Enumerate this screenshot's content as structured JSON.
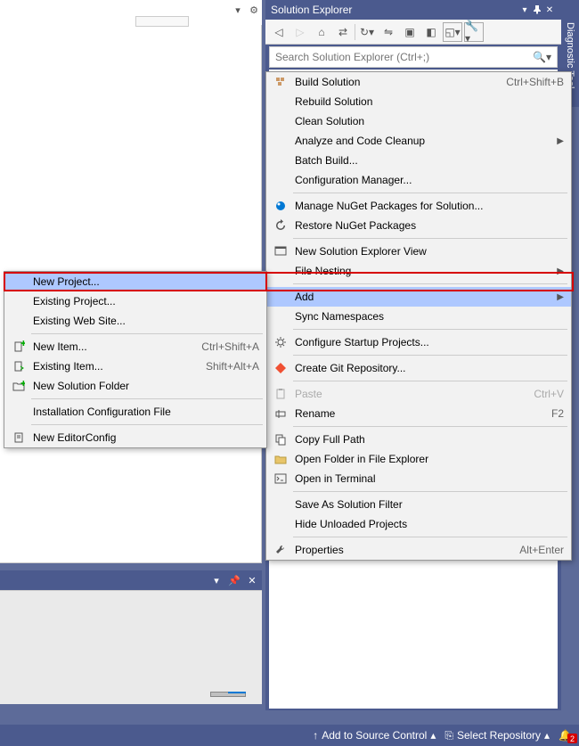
{
  "solution_explorer": {
    "title": "Solution Explorer",
    "search_placeholder": "Search Solution Explorer (Ctrl+;)"
  },
  "side_tab": "Diagnostic Tool",
  "main_menu": [
    {
      "icon": "build",
      "label": "Build Solution",
      "shortcut": "Ctrl+Shift+B"
    },
    {
      "icon": "",
      "label": "Rebuild Solution",
      "shortcut": ""
    },
    {
      "icon": "",
      "label": "Clean Solution",
      "shortcut": ""
    },
    {
      "icon": "",
      "label": "Analyze and Code Cleanup",
      "shortcut": "",
      "submenu": true
    },
    {
      "icon": "",
      "label": "Batch Build...",
      "shortcut": ""
    },
    {
      "icon": "",
      "label": "Configuration Manager...",
      "shortcut": ""
    },
    {
      "sep": true
    },
    {
      "icon": "nuget",
      "label": "Manage NuGet Packages for Solution...",
      "shortcut": ""
    },
    {
      "icon": "restore",
      "label": "Restore NuGet Packages",
      "shortcut": ""
    },
    {
      "sep": true
    },
    {
      "icon": "view",
      "label": "New Solution Explorer View",
      "shortcut": ""
    },
    {
      "icon": "",
      "label": "File Nesting",
      "shortcut": "",
      "submenu": true
    },
    {
      "sep": true
    },
    {
      "icon": "",
      "label": "Add",
      "shortcut": "",
      "submenu": true,
      "highlighted": true
    },
    {
      "icon": "",
      "label": "Sync Namespaces",
      "shortcut": ""
    },
    {
      "sep": true
    },
    {
      "icon": "gear",
      "label": "Configure Startup Projects...",
      "shortcut": ""
    },
    {
      "sep": true
    },
    {
      "icon": "git",
      "label": "Create Git Repository...",
      "shortcut": ""
    },
    {
      "sep": true
    },
    {
      "icon": "paste",
      "label": "Paste",
      "shortcut": "Ctrl+V",
      "disabled": true
    },
    {
      "icon": "rename",
      "label": "Rename",
      "shortcut": "F2"
    },
    {
      "sep": true
    },
    {
      "icon": "copy",
      "label": "Copy Full Path",
      "shortcut": ""
    },
    {
      "icon": "folder",
      "label": "Open Folder in File Explorer",
      "shortcut": ""
    },
    {
      "icon": "terminal",
      "label": "Open in Terminal",
      "shortcut": ""
    },
    {
      "sep": true
    },
    {
      "icon": "",
      "label": "Save As Solution Filter",
      "shortcut": ""
    },
    {
      "icon": "",
      "label": "Hide Unloaded Projects",
      "shortcut": ""
    },
    {
      "sep": true
    },
    {
      "icon": "wrench",
      "label": "Properties",
      "shortcut": "Alt+Enter"
    }
  ],
  "sub_menu": [
    {
      "icon": "",
      "label": "New Project...",
      "shortcut": "",
      "highlighted": true
    },
    {
      "icon": "",
      "label": "Existing Project...",
      "shortcut": ""
    },
    {
      "icon": "",
      "label": "Existing Web Site...",
      "shortcut": ""
    },
    {
      "sep": true
    },
    {
      "icon": "newitem",
      "label": "New Item...",
      "shortcut": "Ctrl+Shift+A"
    },
    {
      "icon": "existitem",
      "label": "Existing Item...",
      "shortcut": "Shift+Alt+A"
    },
    {
      "icon": "folder-new",
      "label": "New Solution Folder",
      "shortcut": ""
    },
    {
      "sep": true
    },
    {
      "icon": "",
      "label": "Installation Configuration File",
      "shortcut": ""
    },
    {
      "sep": true
    },
    {
      "icon": "config",
      "label": "New EditorConfig",
      "shortcut": ""
    }
  ],
  "status_bar": {
    "add_source": "Add to Source Control",
    "select_repo": "Select Repository",
    "notifications": "2"
  }
}
